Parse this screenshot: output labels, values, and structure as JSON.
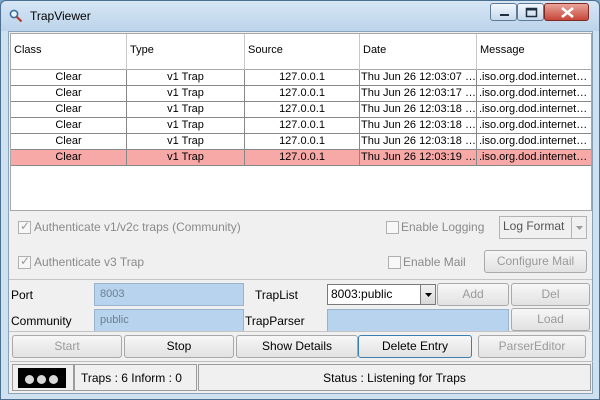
{
  "window": {
    "title": "TrapViewer"
  },
  "table": {
    "columns": [
      "Class",
      "Type",
      "Source",
      "Date",
      "Message"
    ],
    "rows": [
      [
        "Clear",
        "v1 Trap",
        "127.0.0.1",
        "Thu Jun 26 12:03:07 …",
        ".iso.org.dod.internet…"
      ],
      [
        "Clear",
        "v1 Trap",
        "127.0.0.1",
        "Thu Jun 26 12:03:17 …",
        ".iso.org.dod.internet…"
      ],
      [
        "Clear",
        "v1 Trap",
        "127.0.0.1",
        "Thu Jun 26 12:03:18 …",
        ".iso.org.dod.internet…"
      ],
      [
        "Clear",
        "v1 Trap",
        "127.0.0.1",
        "Thu Jun 26 12:03:18 …",
        ".iso.org.dod.internet…"
      ],
      [
        "Clear",
        "v1 Trap",
        "127.0.0.1",
        "Thu Jun 26 12:03:18 …",
        ".iso.org.dod.internet…"
      ],
      [
        "Clear",
        "v1 Trap",
        "127.0.0.1",
        "Thu Jun 26 12:03:19 …",
        ".iso.org.dod.internet…"
      ]
    ],
    "selected_row": 5,
    "selected_color": "#f7a9a8"
  },
  "options": {
    "auth_v1v2c": "Authenticate v1/v2c traps (Community)",
    "auth_v3": "Authenticate v3 Trap",
    "enable_logging": "Enable Logging",
    "enable_mail": "Enable Mail",
    "log_format": "Log Format",
    "configure_mail": "Configure Mail"
  },
  "settings": {
    "port_label": "Port",
    "port_value": "8003",
    "community_label": "Community",
    "community_value": "public",
    "traplist_label": "TrapList",
    "traplist_value": "8003:public",
    "trapparser_label": "TrapParser",
    "trapparser_value": "",
    "add": "Add",
    "del": "Del",
    "load": "Load"
  },
  "actions": {
    "start": "Start",
    "stop": "Stop",
    "show_details": "Show Details",
    "delete_entry": "Delete Entry",
    "parser_editor": "ParserEditor"
  },
  "status": {
    "counts": "Traps  : 6 Inform  : 0",
    "message": "Status : Listening for Traps"
  },
  "colors": {
    "field_bg": "#b8d3ee",
    "titlebar": "#c6dbee",
    "close_button": "#c7463a"
  }
}
